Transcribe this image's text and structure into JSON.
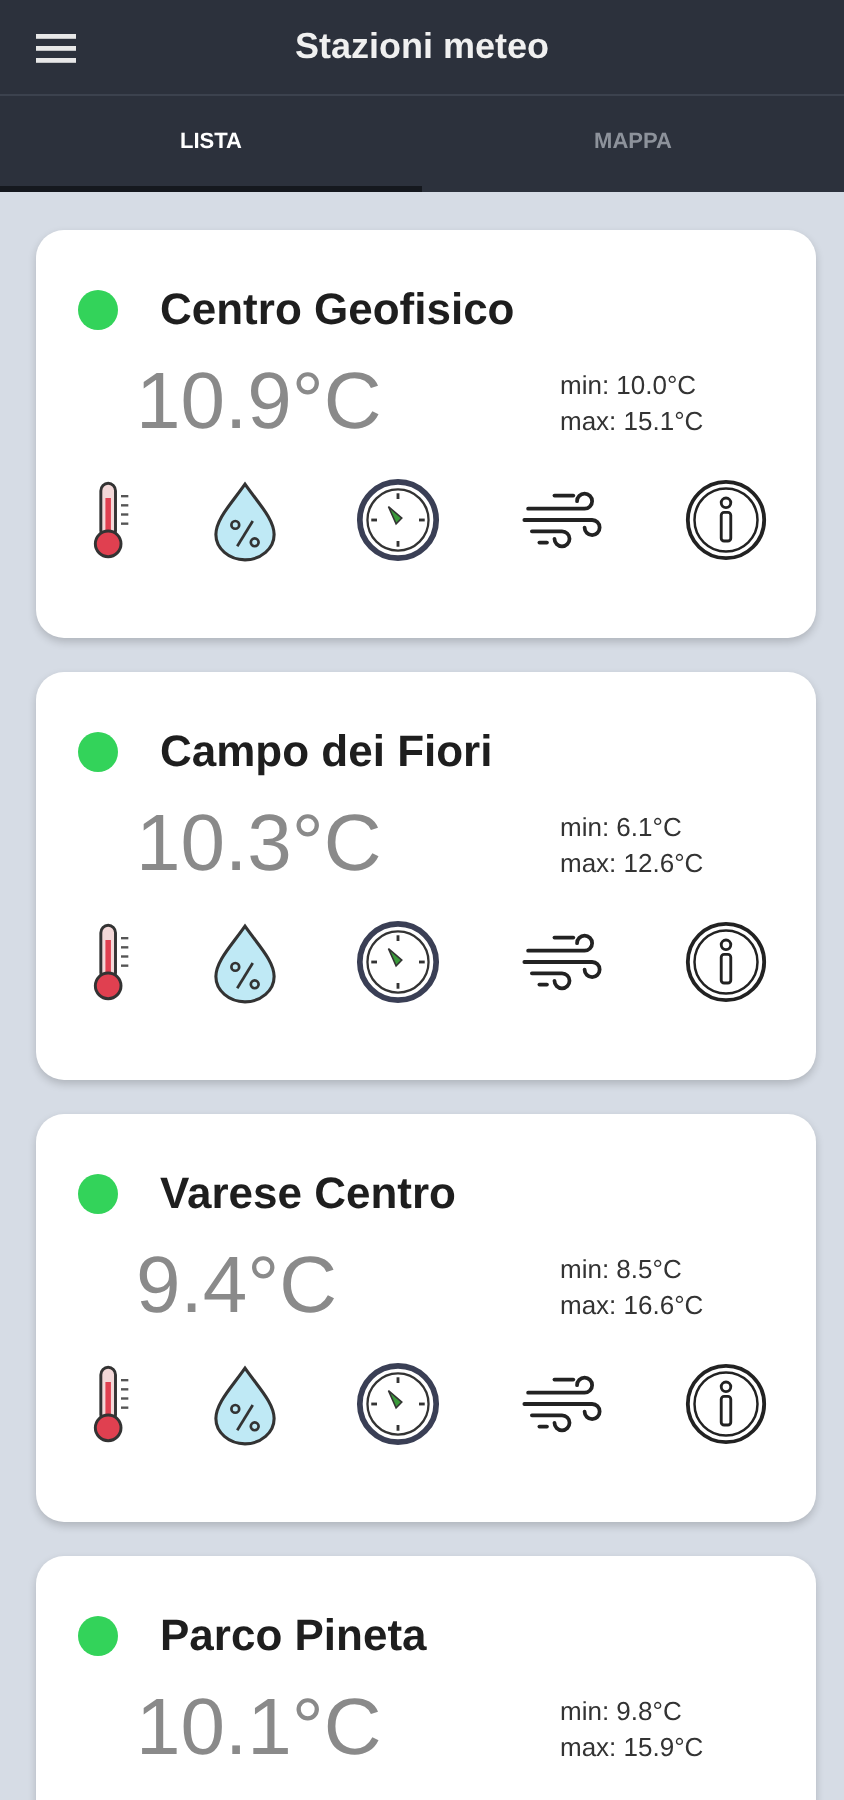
{
  "app_bar": {
    "title": "Stazioni meteo"
  },
  "tabs": [
    {
      "label": "LISTA",
      "selected": true
    },
    {
      "label": "MAPPA",
      "selected": false
    }
  ],
  "stations": [
    {
      "name": "Centro Geofisico",
      "color": "#33d35a",
      "temperature": "10.9°C",
      "min": "min: 10.0°C",
      "max": "max: 15.1°C"
    },
    {
      "name": "Campo dei Fiori",
      "color": "#33d35a",
      "temperature": "10.3°C",
      "min": "min: 6.1°C",
      "max": "max: 12.6°C"
    },
    {
      "name": "Varese Centro",
      "color": "#33d35a",
      "temperature": "9.4°C",
      "min": "min: 8.5°C",
      "max": "max: 16.6°C"
    },
    {
      "name": "Parco Pineta",
      "color": "#33d35a",
      "temperature": "10.1°C",
      "min": "min: 9.8°C",
      "max": "max: 15.9°C"
    }
  ]
}
